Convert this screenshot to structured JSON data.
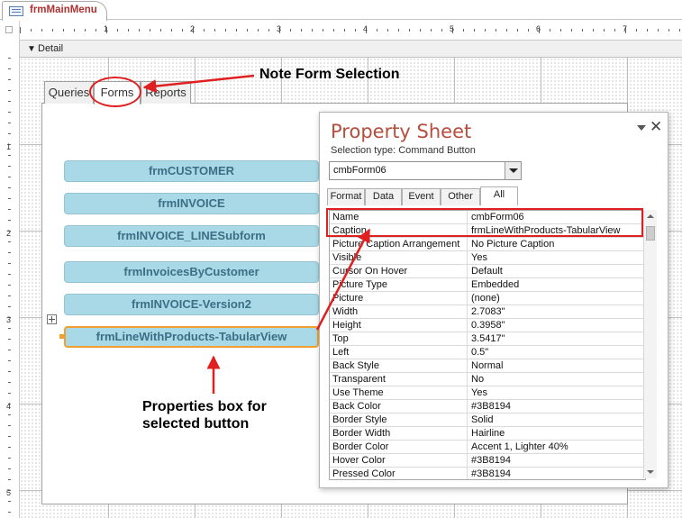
{
  "document_tab": {
    "title": "frmMainMenu"
  },
  "ruler": {
    "top_numbers": [
      "1",
      "2",
      "3",
      "4",
      "5",
      "6",
      "7"
    ],
    "left_numbers": [
      "1",
      "2",
      "3",
      "4",
      "5"
    ]
  },
  "section": {
    "label": "Detail"
  },
  "tab_control": {
    "tabs": [
      {
        "label": "Queries"
      },
      {
        "label": "Forms"
      },
      {
        "label": "Reports"
      }
    ],
    "selected_tab": "Forms"
  },
  "buttons": [
    {
      "label": "frmCUSTOMER"
    },
    {
      "label": "frmINVOICE"
    },
    {
      "label": "frmINVOICE_LINESubform"
    },
    {
      "label": "frmInvoicesByCustomer"
    },
    {
      "label": "frmINVOICE-Version2"
    },
    {
      "label": "frmLineWithProducts-TabularView"
    }
  ],
  "property_sheet": {
    "title": "Property Sheet",
    "selection_type": "Selection type:  Command Button",
    "selected_control": "cmbForm06",
    "tabs": [
      {
        "label": "Format"
      },
      {
        "label": "Data"
      },
      {
        "label": "Event"
      },
      {
        "label": "Other"
      },
      {
        "label": "All"
      }
    ],
    "active_tab": "All",
    "properties": [
      {
        "key": "Name",
        "value": "cmbForm06"
      },
      {
        "key": "Caption",
        "value": "frmLineWithProducts-TabularView"
      },
      {
        "key": "Picture Caption Arrangement",
        "value": "No Picture Caption"
      },
      {
        "key": "Visible",
        "value": "Yes"
      },
      {
        "key": "Cursor On Hover",
        "value": "Default"
      },
      {
        "key": "Picture Type",
        "value": "Embedded"
      },
      {
        "key": "Picture",
        "value": "(none)"
      },
      {
        "key": "Width",
        "value": "2.7083\""
      },
      {
        "key": "Height",
        "value": "0.3958\""
      },
      {
        "key": "Top",
        "value": "3.5417\""
      },
      {
        "key": "Left",
        "value": "0.5\""
      },
      {
        "key": "Back Style",
        "value": "Normal"
      },
      {
        "key": "Transparent",
        "value": "No"
      },
      {
        "key": "Use Theme",
        "value": "Yes"
      },
      {
        "key": "Back Color",
        "value": "#3B8194"
      },
      {
        "key": "Border Style",
        "value": "Solid"
      },
      {
        "key": "Border Width",
        "value": "Hairline"
      },
      {
        "key": "Border Color",
        "value": "Accent 1, Lighter 40%"
      },
      {
        "key": "Hover Color",
        "value": "#3B8194"
      },
      {
        "key": "Pressed Color",
        "value": "#3B8194"
      }
    ]
  },
  "annotations": {
    "form_selection_note": "Note Form Selection",
    "properties_note_line1": "Properties box for",
    "properties_note_line2": "selected button"
  },
  "colors": {
    "button_fill": "#a9d8e7",
    "button_text": "#3a6f86",
    "selection_border": "#f0a030",
    "annotation_red": "#e02020",
    "title_red": "#b64e3e"
  }
}
